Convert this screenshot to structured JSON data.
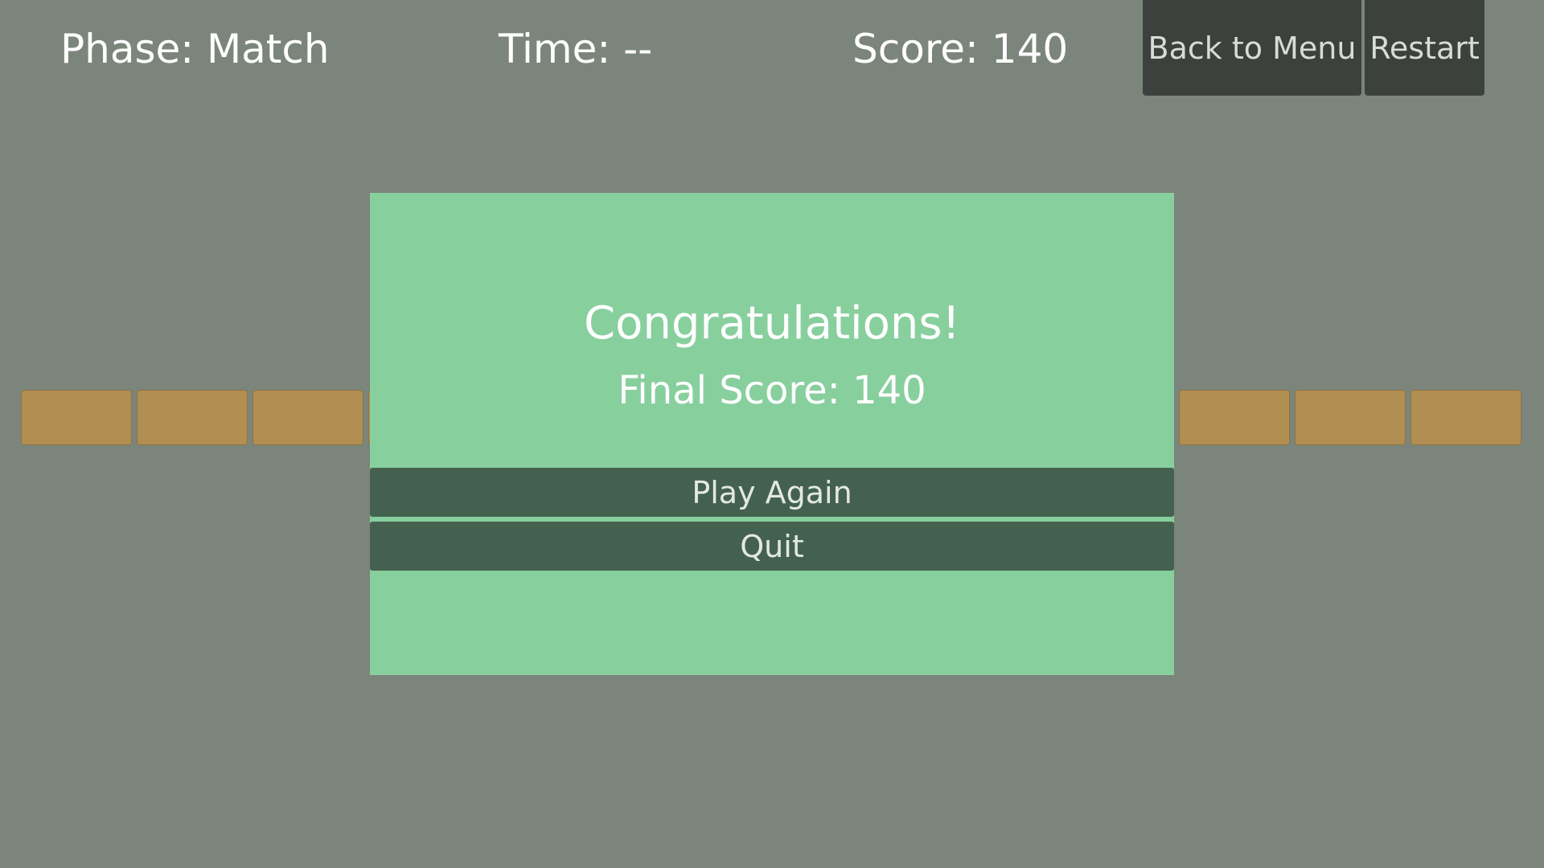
{
  "hud": {
    "phase": "Phase: Match",
    "time": "Time: --",
    "score": "Score: 140",
    "back_to_menu": "Back to Menu",
    "restart": "Restart"
  },
  "dialog": {
    "title": "Congratulations!",
    "final_score": "Final Score: 140",
    "play_again": "Play Again",
    "quit": "Quit"
  },
  "colors": {
    "background": "#7b857b",
    "dialog": "#88cf9e",
    "dialog_button": "#44614f",
    "hud_button": "#3c413e",
    "tile": "#b18e51"
  }
}
